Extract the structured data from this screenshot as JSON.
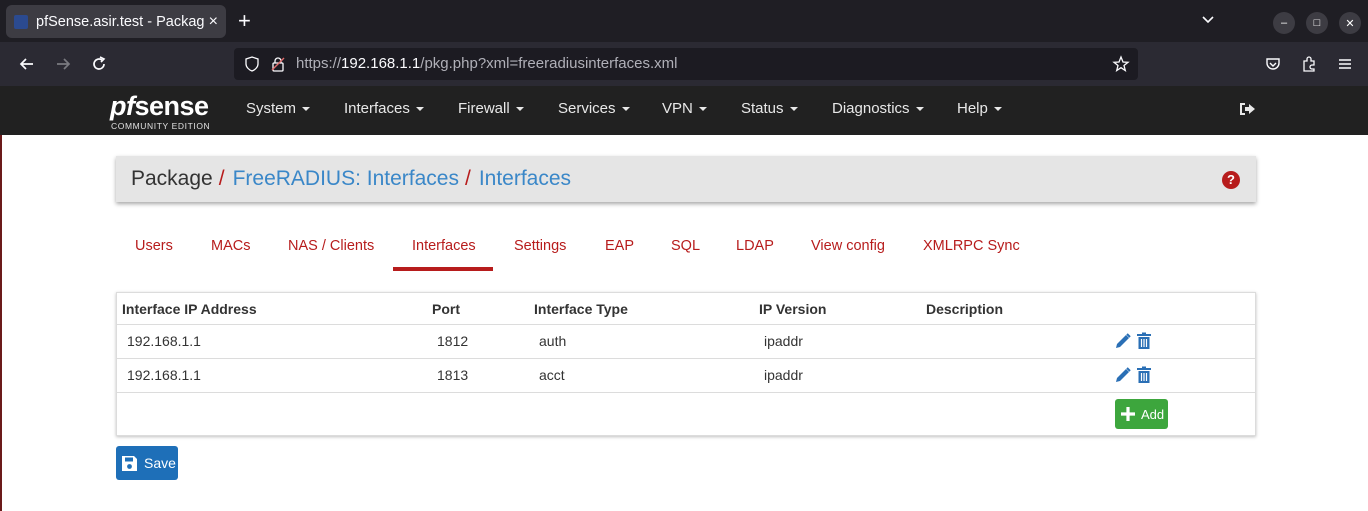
{
  "browser": {
    "tab_title": "pfSense.asir.test - Package",
    "tab_close": "×",
    "new_tab": "+",
    "url_prefix": "https://",
    "url_host": "192.168.1.1",
    "url_path": "/pkg.php?xml=freeradiusinterfaces.xml"
  },
  "logo": {
    "pf": "pf",
    "sense": "sense",
    "edition": "COMMUNITY EDITION"
  },
  "menu": [
    "System",
    "Interfaces",
    "Firewall",
    "Services",
    "VPN",
    "Status",
    "Diagnostics",
    "Help"
  ],
  "breadcrumb": {
    "root": "Package",
    "sep": "/",
    "level1": "FreeRADIUS: Interfaces",
    "level2": "Interfaces",
    "help": "?"
  },
  "tabs": [
    "Users",
    "MACs",
    "NAS / Clients",
    "Interfaces",
    "Settings",
    "EAP",
    "SQL",
    "LDAP",
    "View config",
    "XMLRPC Sync"
  ],
  "active_tab": "Interfaces",
  "table": {
    "headers": [
      "Interface IP Address",
      "Port",
      "Interface Type",
      "IP Version",
      "Description"
    ],
    "rows": [
      [
        "192.168.1.1",
        "1812",
        "auth",
        "ipaddr",
        ""
      ],
      [
        "192.168.1.1",
        "1813",
        "acct",
        "ipaddr",
        ""
      ]
    ]
  },
  "buttons": {
    "add": "Add",
    "save": "Save"
  },
  "colors": {
    "accent_red": "#b71c1c",
    "link_blue": "#3a87c8",
    "add_green": "#3da63d",
    "save_blue": "#1e6fb8",
    "navbar_bg": "#212121"
  }
}
